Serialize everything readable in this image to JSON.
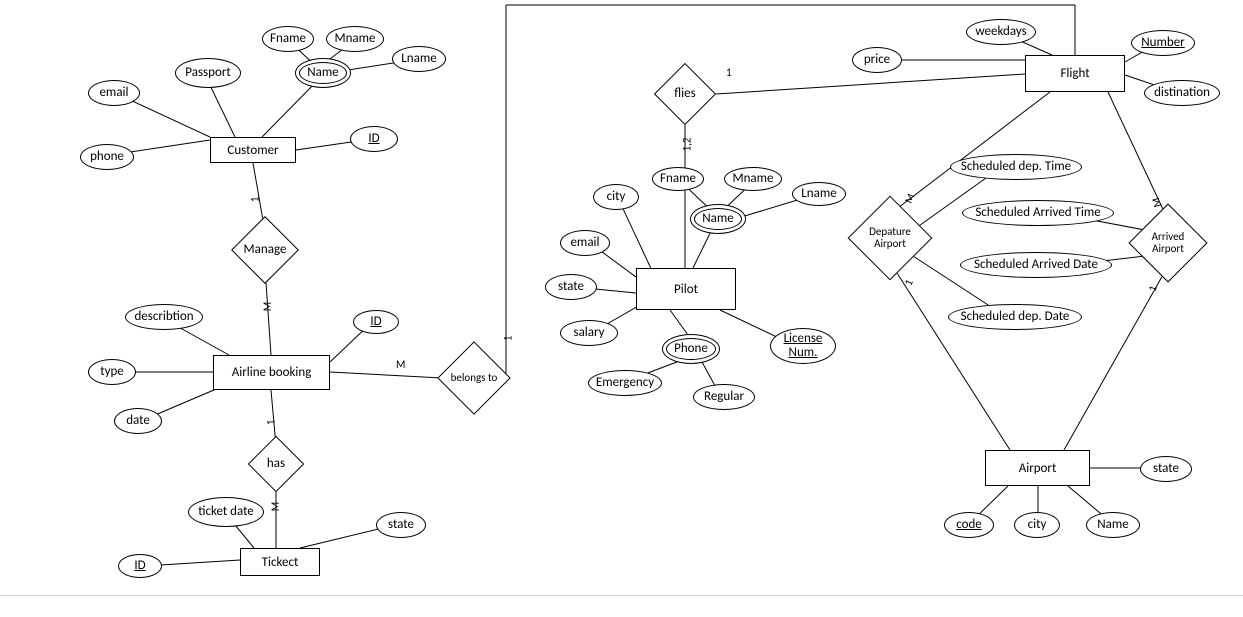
{
  "entities": {
    "customer": "Customer",
    "airline_booking": "Airline booking",
    "ticket": "Tickect",
    "pilot": "Pilot",
    "flight": "Flight",
    "airport": "Airport"
  },
  "relationships": {
    "manage": "Manage",
    "has": "has",
    "belongs_to": "belongs to",
    "flies": "flies",
    "dep_airport": "Depature Airport",
    "arr_airport": "Arrived Airport"
  },
  "attrs": {
    "customer": {
      "email": "email",
      "passport": "Passport",
      "name": "Name",
      "fname": "Fname",
      "mname": "Mname",
      "lname": "Lname",
      "id": "ID",
      "phone": "phone"
    },
    "booking": {
      "id": "ID",
      "describtion": "describtion",
      "type": "type",
      "date": "date"
    },
    "ticket": {
      "ticket_date": "ticket date",
      "state": "state",
      "id": "ID"
    },
    "pilot": {
      "city": "city",
      "email": "email",
      "state": "state",
      "salary": "salary",
      "name": "Name",
      "fname": "Fname",
      "mname": "Mname",
      "lname": "Lname",
      "phone": "Phone",
      "emergency": "Emergency",
      "regular": "Regular",
      "license": "License Num."
    },
    "flight": {
      "price": "price",
      "weekdays": "weekdays",
      "number": "Number",
      "distination": "distination",
      "sched_dep_time": "Scheduled dep. Time",
      "sched_arr_time": "Scheduled Arrived Time",
      "sched_arr_date": "Scheduled Arrived Date",
      "sched_dep_date": "Scheduled dep. Date"
    },
    "airport": {
      "state": "state",
      "code": "code",
      "city": "city",
      "name": "Name"
    }
  },
  "card": {
    "one": "1",
    "many": "M",
    "one_two": "1,2"
  }
}
